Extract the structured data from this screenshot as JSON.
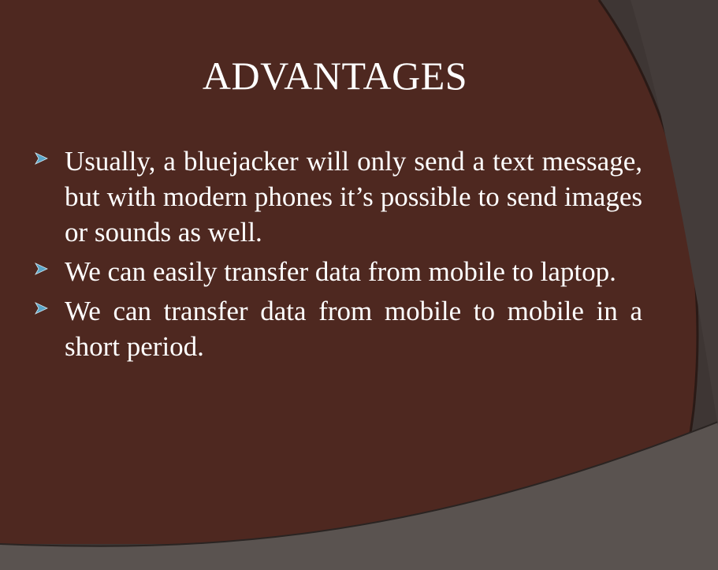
{
  "slide": {
    "title": "ADVANTAGES",
    "bullets": [
      {
        "text": "Usually, a bluejacker will only send a text message, but with modern phones it’s possible to send images or sounds as well."
      },
      {
        "text": "We can easily transfer data from mobile to laptop."
      },
      {
        "text": "We can transfer data from mobile to mobile in a short period."
      }
    ],
    "bullet_icon": "arrow-bullet-icon"
  },
  "colors": {
    "main_panel": "#4e2820",
    "outer_dark": "#3e3634",
    "swoosh_light": "#5a5350",
    "text": "#ffffff",
    "bullet_accent": "#5aa6c8"
  }
}
